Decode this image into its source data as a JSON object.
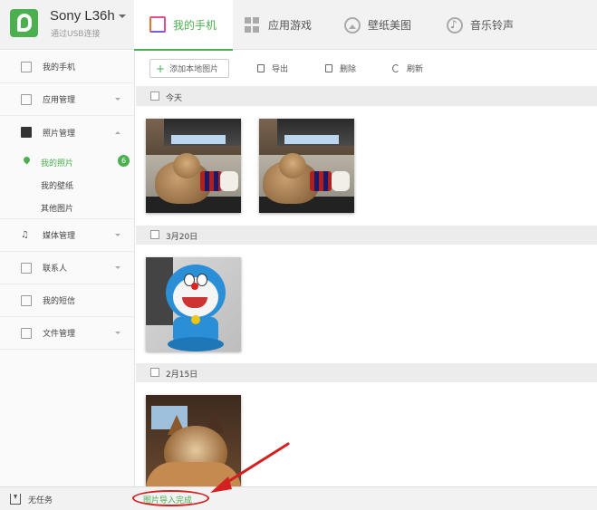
{
  "header": {
    "device_name": "Sony L36h",
    "device_sub": "通过USB连接",
    "tabs": [
      {
        "label": "我的手机"
      },
      {
        "label": "应用游戏"
      },
      {
        "label": "壁纸美图"
      },
      {
        "label": "音乐铃声"
      }
    ]
  },
  "sidebar": {
    "items": [
      {
        "label": "我的手机"
      },
      {
        "label": "应用管理"
      },
      {
        "label": "照片管理"
      },
      {
        "label": "媒体管理"
      },
      {
        "label": "联系人"
      },
      {
        "label": "我的短信"
      },
      {
        "label": "文件管理"
      }
    ],
    "sub_items": [
      {
        "label": "我的照片",
        "badge": "6"
      },
      {
        "label": "我的壁纸"
      },
      {
        "label": "其他图片"
      }
    ]
  },
  "toolbar": {
    "add_label": "添加本地图片",
    "export_label": "导出",
    "delete_label": "删除",
    "refresh_label": "刷新"
  },
  "groups": [
    {
      "label": "今天"
    },
    {
      "label": "3月20日"
    },
    {
      "label": "2月15日"
    }
  ],
  "status": {
    "task_label": "无任务",
    "import_status": "图片导入完成"
  },
  "colors": {
    "accent": "#4caf50",
    "annotation": "#d32020"
  }
}
